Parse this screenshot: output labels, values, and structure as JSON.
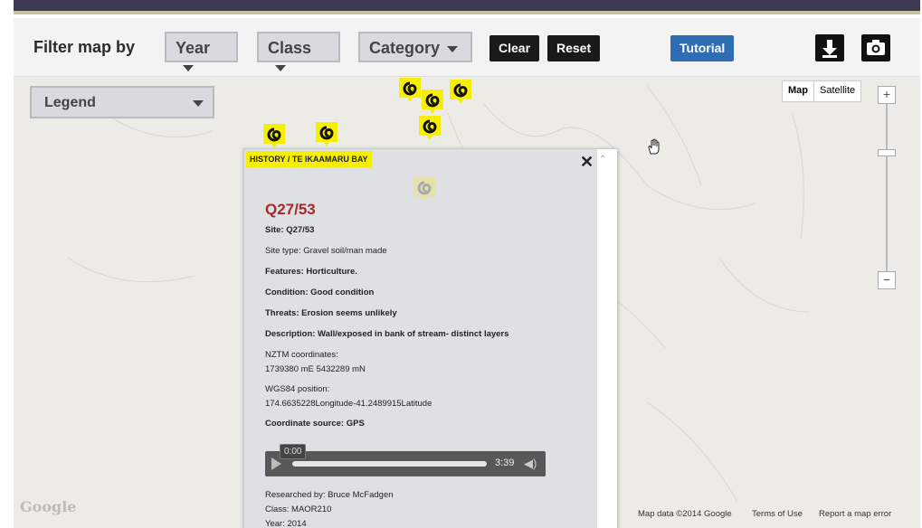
{
  "filterbar": {
    "title": "Filter map by",
    "year": "Year",
    "class": "Class",
    "category": "Category",
    "clear": "Clear",
    "reset": "Reset",
    "tutorial": "Tutorial",
    "download_icon": "download-icon",
    "camera_icon": "camera-icon"
  },
  "legend": {
    "label": "Legend"
  },
  "map_toggle": {
    "map": "Map",
    "satellite": "Satellite"
  },
  "zoom": {
    "plus": "+",
    "minus": "−"
  },
  "popup": {
    "tag": "HISTORY / TE IKAAMARU BAY",
    "close": "✕",
    "title": "Q27/53",
    "site": "Site: Q27/53",
    "site_type": "Site type: Gravel soil/man made",
    "features": "Features: Horticulture.",
    "condition": "Condition: Good condition",
    "threats": "Threats: Erosion seems unlikely",
    "description": "Description: Wall/exposed in bank of stream- distinct layers",
    "nztm_label": "NZTM coordinates:",
    "nztm_value": "1739380 mE 5432289 mN",
    "wgs_label": "WGS84 position:",
    "wgs_value": "174.6635228Longitude-41.2489915Latitude",
    "coord_source": "Coordinate source: GPS",
    "audio_current": "0:00",
    "audio_duration": "3:39",
    "researched_by": "Researched by: Bruce McFadgen",
    "class": "Class: MAOR210",
    "year_partial": "Year: 2014"
  },
  "footer": {
    "google": "Google",
    "map_data": "Map data ©2014 Google",
    "terms": "Terms of Use",
    "report": "Report a map error"
  },
  "colors": {
    "marker": "#f7ef00",
    "tutorial": "#2f6db3",
    "title_red": "#a52a2a"
  }
}
